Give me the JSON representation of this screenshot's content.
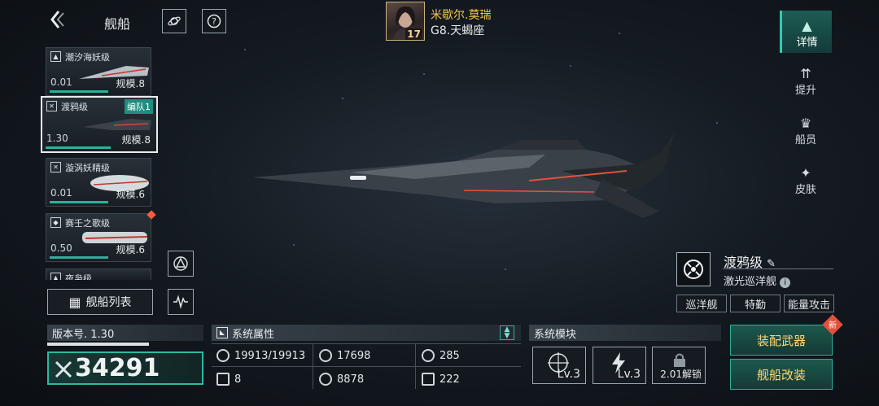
{
  "header": {
    "title": "舰船",
    "back_icon": "chevron-left-icon",
    "icons": [
      "planet-icon",
      "help-icon"
    ]
  },
  "captain": {
    "name": "米歇尔.莫瑞",
    "level": "17",
    "rank": "G8.天蝎座"
  },
  "ship_list": [
    {
      "name": "潮汐海妖级",
      "ratio": "0.01",
      "scale": "规模.8",
      "progress": 0.5
    },
    {
      "name": "渡鸦级",
      "ratio": "1.30",
      "scale": "规模.8",
      "team": "编队1",
      "selected": true,
      "progress": 0.6
    },
    {
      "name": "漩涡妖精级",
      "ratio": "0.01",
      "scale": "规模.6",
      "progress": 0.5
    },
    {
      "name": "赛壬之歌级",
      "ratio": "0.50",
      "scale": "规模.6",
      "new": true,
      "progress": 0.5
    },
    {
      "name": "夜枭级"
    }
  ],
  "fleet_list_label": "舰船列表",
  "side_nav": [
    {
      "label": "详情",
      "icon": "details-icon",
      "active": true
    },
    {
      "label": "提升",
      "icon": "upgrade-icon"
    },
    {
      "label": "船员",
      "icon": "crew-icon"
    },
    {
      "label": "皮肤",
      "icon": "skin-icon"
    }
  ],
  "ship_info": {
    "name": "渡鸦级",
    "type": "激光巡洋舰",
    "tags": [
      "巡洋舰",
      "特勤",
      "能量攻击"
    ]
  },
  "version": {
    "label": "版本号. 1.30",
    "power": "34291"
  },
  "stats": {
    "title": "系统属性",
    "items": [
      {
        "icon": "hull-icon",
        "value": "19913/19913"
      },
      {
        "icon": "armor-icon",
        "value": "17698"
      },
      {
        "icon": "shield-icon",
        "value": "285"
      },
      {
        "icon": "grid-icon",
        "value": "8"
      },
      {
        "icon": "energy-icon",
        "value": "8878"
      },
      {
        "icon": "speed-icon",
        "value": "222"
      }
    ]
  },
  "modules": {
    "title": "系统模块",
    "slots": [
      {
        "icon": "targeting-module-icon",
        "level": "Lv.3"
      },
      {
        "icon": "power-module-icon",
        "level": "Lv.3"
      },
      {
        "icon": "lock-icon",
        "level": "2.01解锁"
      }
    ]
  },
  "actions": {
    "equip": "装配武器",
    "refit": "舰船改装",
    "new_badge": "新"
  },
  "colors": {
    "accent": "#2fae9a",
    "gold": "#f1c84f",
    "alert": "#ff5a36"
  }
}
